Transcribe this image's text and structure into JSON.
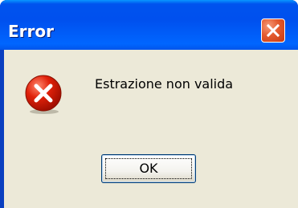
{
  "window": {
    "title": "Error",
    "close_icon": "close-icon"
  },
  "dialog": {
    "icon": "error-icon",
    "message": "Estrazione non valida",
    "ok_label": "OK"
  },
  "colors": {
    "titlebar": "#0055ea",
    "client_bg": "#ece9d8",
    "close_button": "#e35a2e",
    "error_icon": "#d81e05"
  }
}
